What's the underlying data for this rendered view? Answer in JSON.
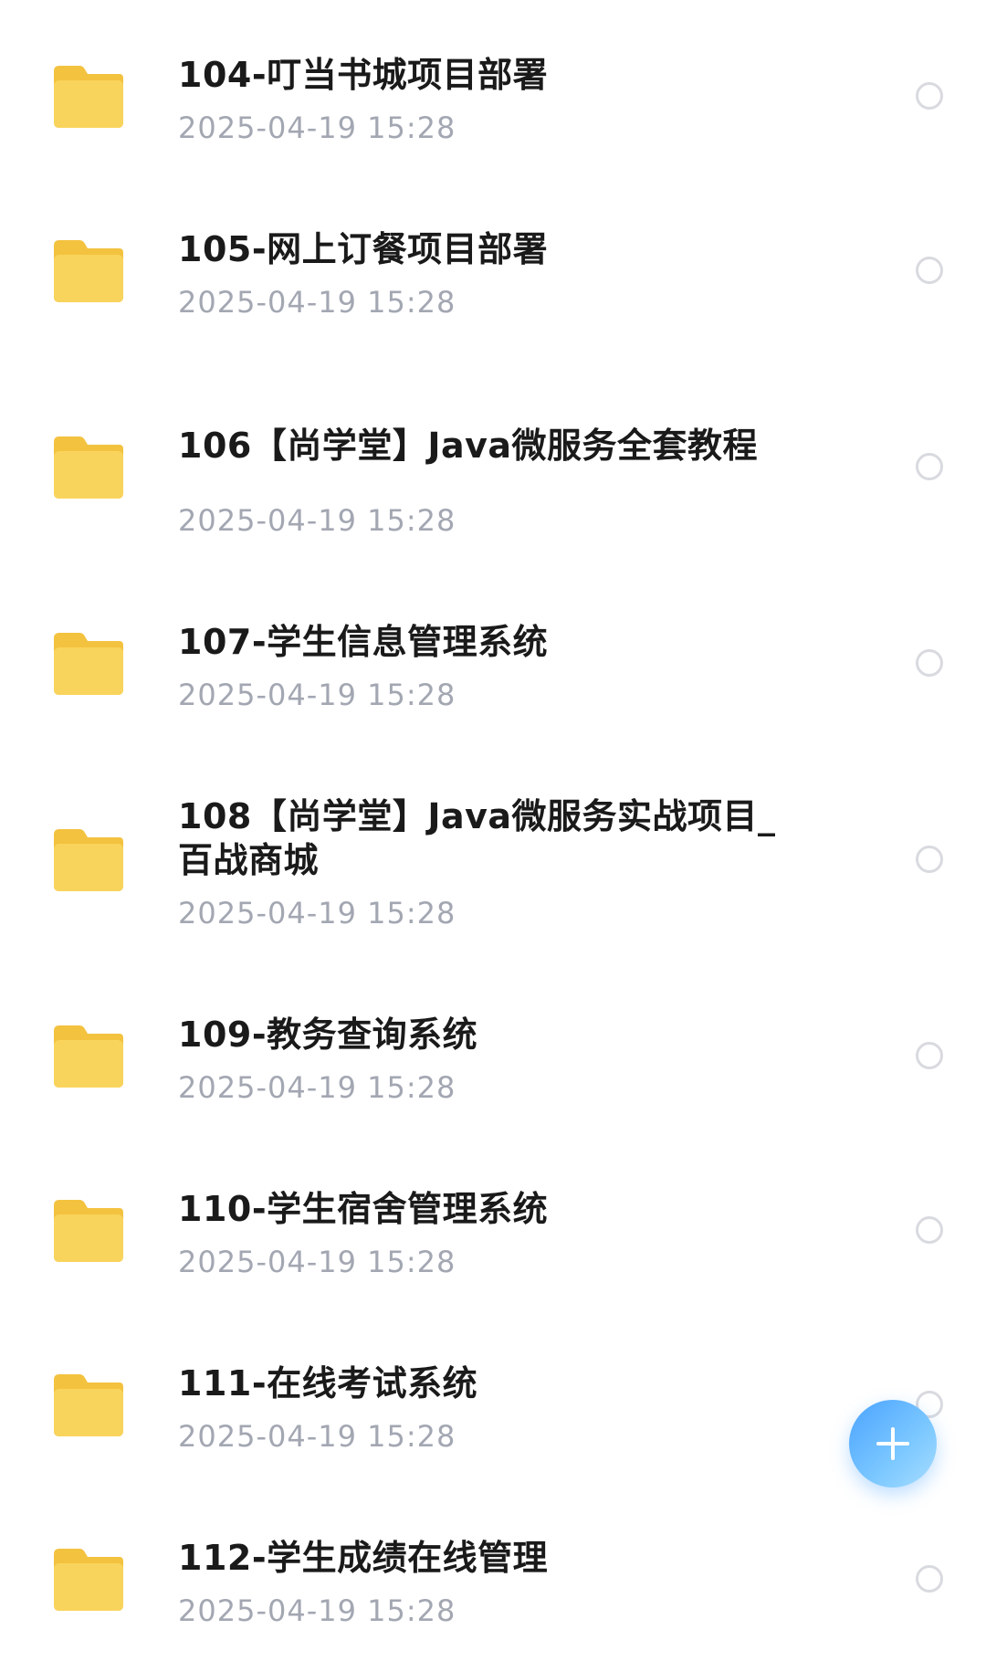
{
  "files": [
    {
      "name": "104-叮当书城项目部署",
      "date": "2025-04-19 15:28",
      "icon": "folder-icon"
    },
    {
      "name": "105-网上订餐项目部署",
      "date": "2025-04-19 15:28",
      "icon": "folder-icon"
    },
    {
      "name": "106【尚学堂】Java微服务全套教程",
      "date": "2025-04-19 15:28",
      "icon": "folder-icon"
    },
    {
      "name": "107-学生信息管理系统",
      "date": "2025-04-19 15:28",
      "icon": "folder-icon"
    },
    {
      "name": "108【尚学堂】Java微服务实战项目_百战商城",
      "date": "2025-04-19 15:28",
      "icon": "folder-icon"
    },
    {
      "name": "109-教务查询系统",
      "date": "2025-04-19 15:28",
      "icon": "folder-icon"
    },
    {
      "name": "110-学生宿舍管理系统",
      "date": "2025-04-19 15:28",
      "icon": "folder-icon"
    },
    {
      "name": "111-在线考试系统",
      "date": "2025-04-19 15:28",
      "icon": "folder-icon"
    },
    {
      "name": "112-学生成绩在线管理",
      "date": "2025-04-19 15:28",
      "icon": "folder-icon"
    }
  ],
  "fab": {
    "icon": "plus-icon",
    "color": "#4aa3ff"
  },
  "colors": {
    "folder": "#f9d45c",
    "folder_tab": "#f3c23f",
    "date_text": "#a3a7b2"
  }
}
